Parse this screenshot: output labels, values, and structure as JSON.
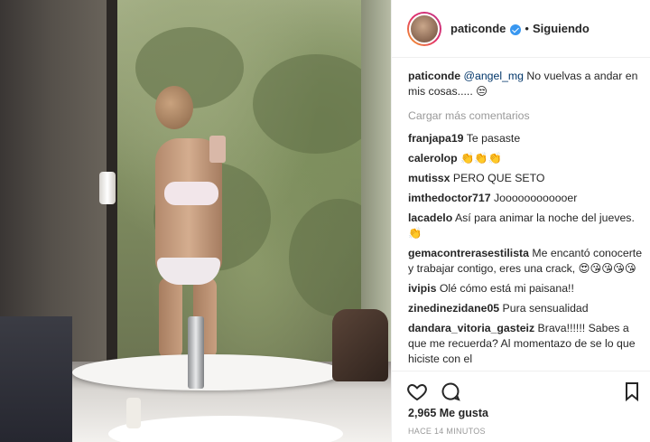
{
  "post": {
    "username": "paticonde",
    "separator": "•",
    "follow_status": "Siguiendo"
  },
  "caption": {
    "user": "paticonde",
    "mention": "@angel_mg",
    "text": " No vuelvas a andar en mis cosas..... 😒"
  },
  "load_more": "Cargar más comentarios",
  "comments": [
    {
      "user": "franjapa19",
      "text": " Te pasaste"
    },
    {
      "user": "calerolop",
      "text": " 👏👏👏"
    },
    {
      "user": "mutissx",
      "text": " PERO QUE SETO"
    },
    {
      "user": "imthedoctor717",
      "text": " Joooooooooooer"
    },
    {
      "user": "lacadelo",
      "text": " Así para animar la noche del jueves.👏"
    },
    {
      "user": "gemacontrerasestilista",
      "text": " Me encantó conocerte y trabajar contigo, eres una crack, 😍😘😘😘😘"
    },
    {
      "user": "ivipis",
      "text": " Olé cómo está mi paisana!!"
    },
    {
      "user": "zinedinezidane05",
      "text": " Pura sensualidad"
    },
    {
      "user": "dandara_vitoria_gasteiz",
      "text": " Brava!!!!!! Sabes a que me recuerda? Al momentazo de se lo que hiciste con el"
    }
  ],
  "likes": "2,965 Me gusta",
  "timestamp": "HACE 14 MINUTOS",
  "icons": {
    "heart": "heart-icon",
    "comment": "comment-icon",
    "bookmark": "bookmark-icon",
    "verified": "verified-badge-icon"
  },
  "colors": {
    "verified": "#3897f0",
    "muted": "#999999",
    "text": "#262626",
    "mention": "#003569"
  }
}
